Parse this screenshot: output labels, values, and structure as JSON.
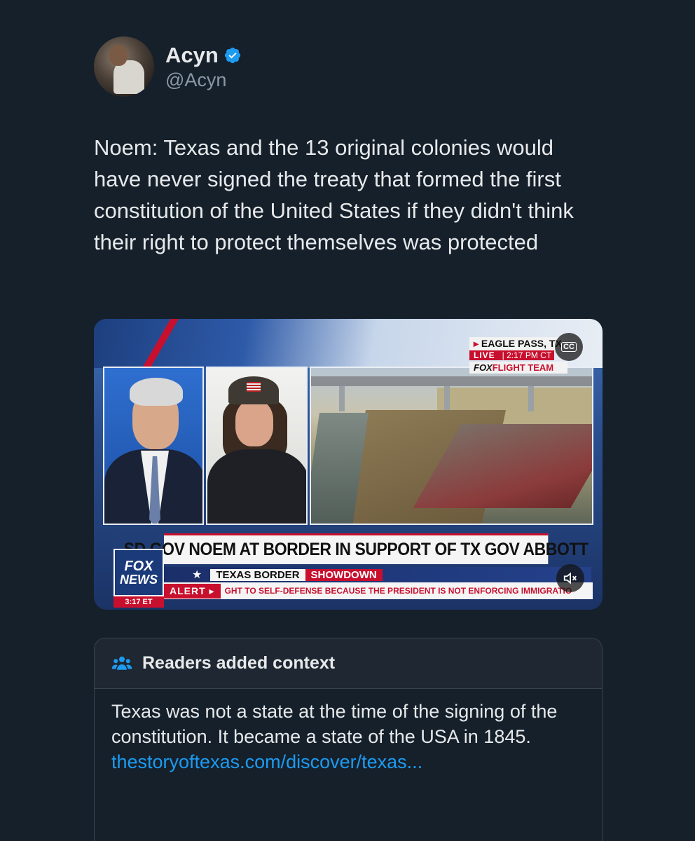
{
  "author": {
    "display_name": "Acyn",
    "handle": "@Acyn",
    "verified": true,
    "verified_color": "#1d9bf0"
  },
  "tweet": {
    "text": "Noem: Texas and the 13 original colonies would have never signed the treaty that formed the first constitution of the United States if they didn't think their right to protect themselves was protected"
  },
  "video": {
    "location": "EAGLE PASS, TX",
    "live_label": "LIVE",
    "live_time": "| 2:17 PM CT",
    "flight_team_fox": "FOX",
    "flight_team_label": "FLIGHT TEAM",
    "headline": "SD GOV NOEM AT BORDER IN SUPPORT OF TX GOV ABBOTT",
    "segment_label": "TEXAS BORDER",
    "segment_highlight": "SHOWDOWN",
    "alert_label": "ALERT ▸",
    "ticker": "GHT TO SELF-DEFENSE BECAUSE THE PRESIDENT IS NOT ENFORCING IMMIGRATIO",
    "logo_line1": "FOX",
    "logo_line2": "NEWS",
    "clock": "3:17 ET",
    "cc_label": "CC",
    "mute_icon": "speaker-muted-icon"
  },
  "community_note": {
    "title": "Readers added context",
    "body": "Texas was not a state at the time of the signing of the constitution. It became a state of the USA in 1845.",
    "link": "thestoryoftexas.com/discover/texas...",
    "link_color": "#1d9bf0"
  }
}
